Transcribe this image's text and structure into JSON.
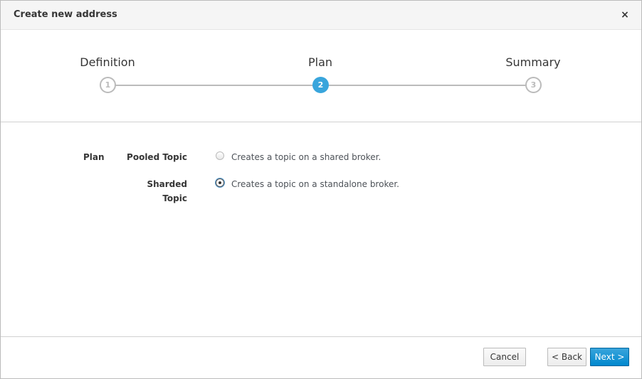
{
  "dialog": {
    "title": "Create new address",
    "close_glyph": "×"
  },
  "wizard": {
    "steps": [
      {
        "label": "Definition",
        "number": "1",
        "active": false
      },
      {
        "label": "Plan",
        "number": "2",
        "active": true
      },
      {
        "label": "Summary",
        "number": "3",
        "active": false
      }
    ]
  },
  "form": {
    "field_label": "Plan",
    "options": [
      {
        "label": "Pooled Topic",
        "description": "Creates a topic on a shared broker.",
        "selected": false
      },
      {
        "label_line1": "Sharded",
        "label_line2": "Topic",
        "description": "Creates a topic on a standalone broker.",
        "selected": true
      }
    ]
  },
  "footer": {
    "cancel_label": "Cancel",
    "back_label": "< Back",
    "next_label": "Next >"
  },
  "colors": {
    "accent": "#39a5dc",
    "primary_button": "#0088ce",
    "header_bg": "#f5f5f5"
  }
}
